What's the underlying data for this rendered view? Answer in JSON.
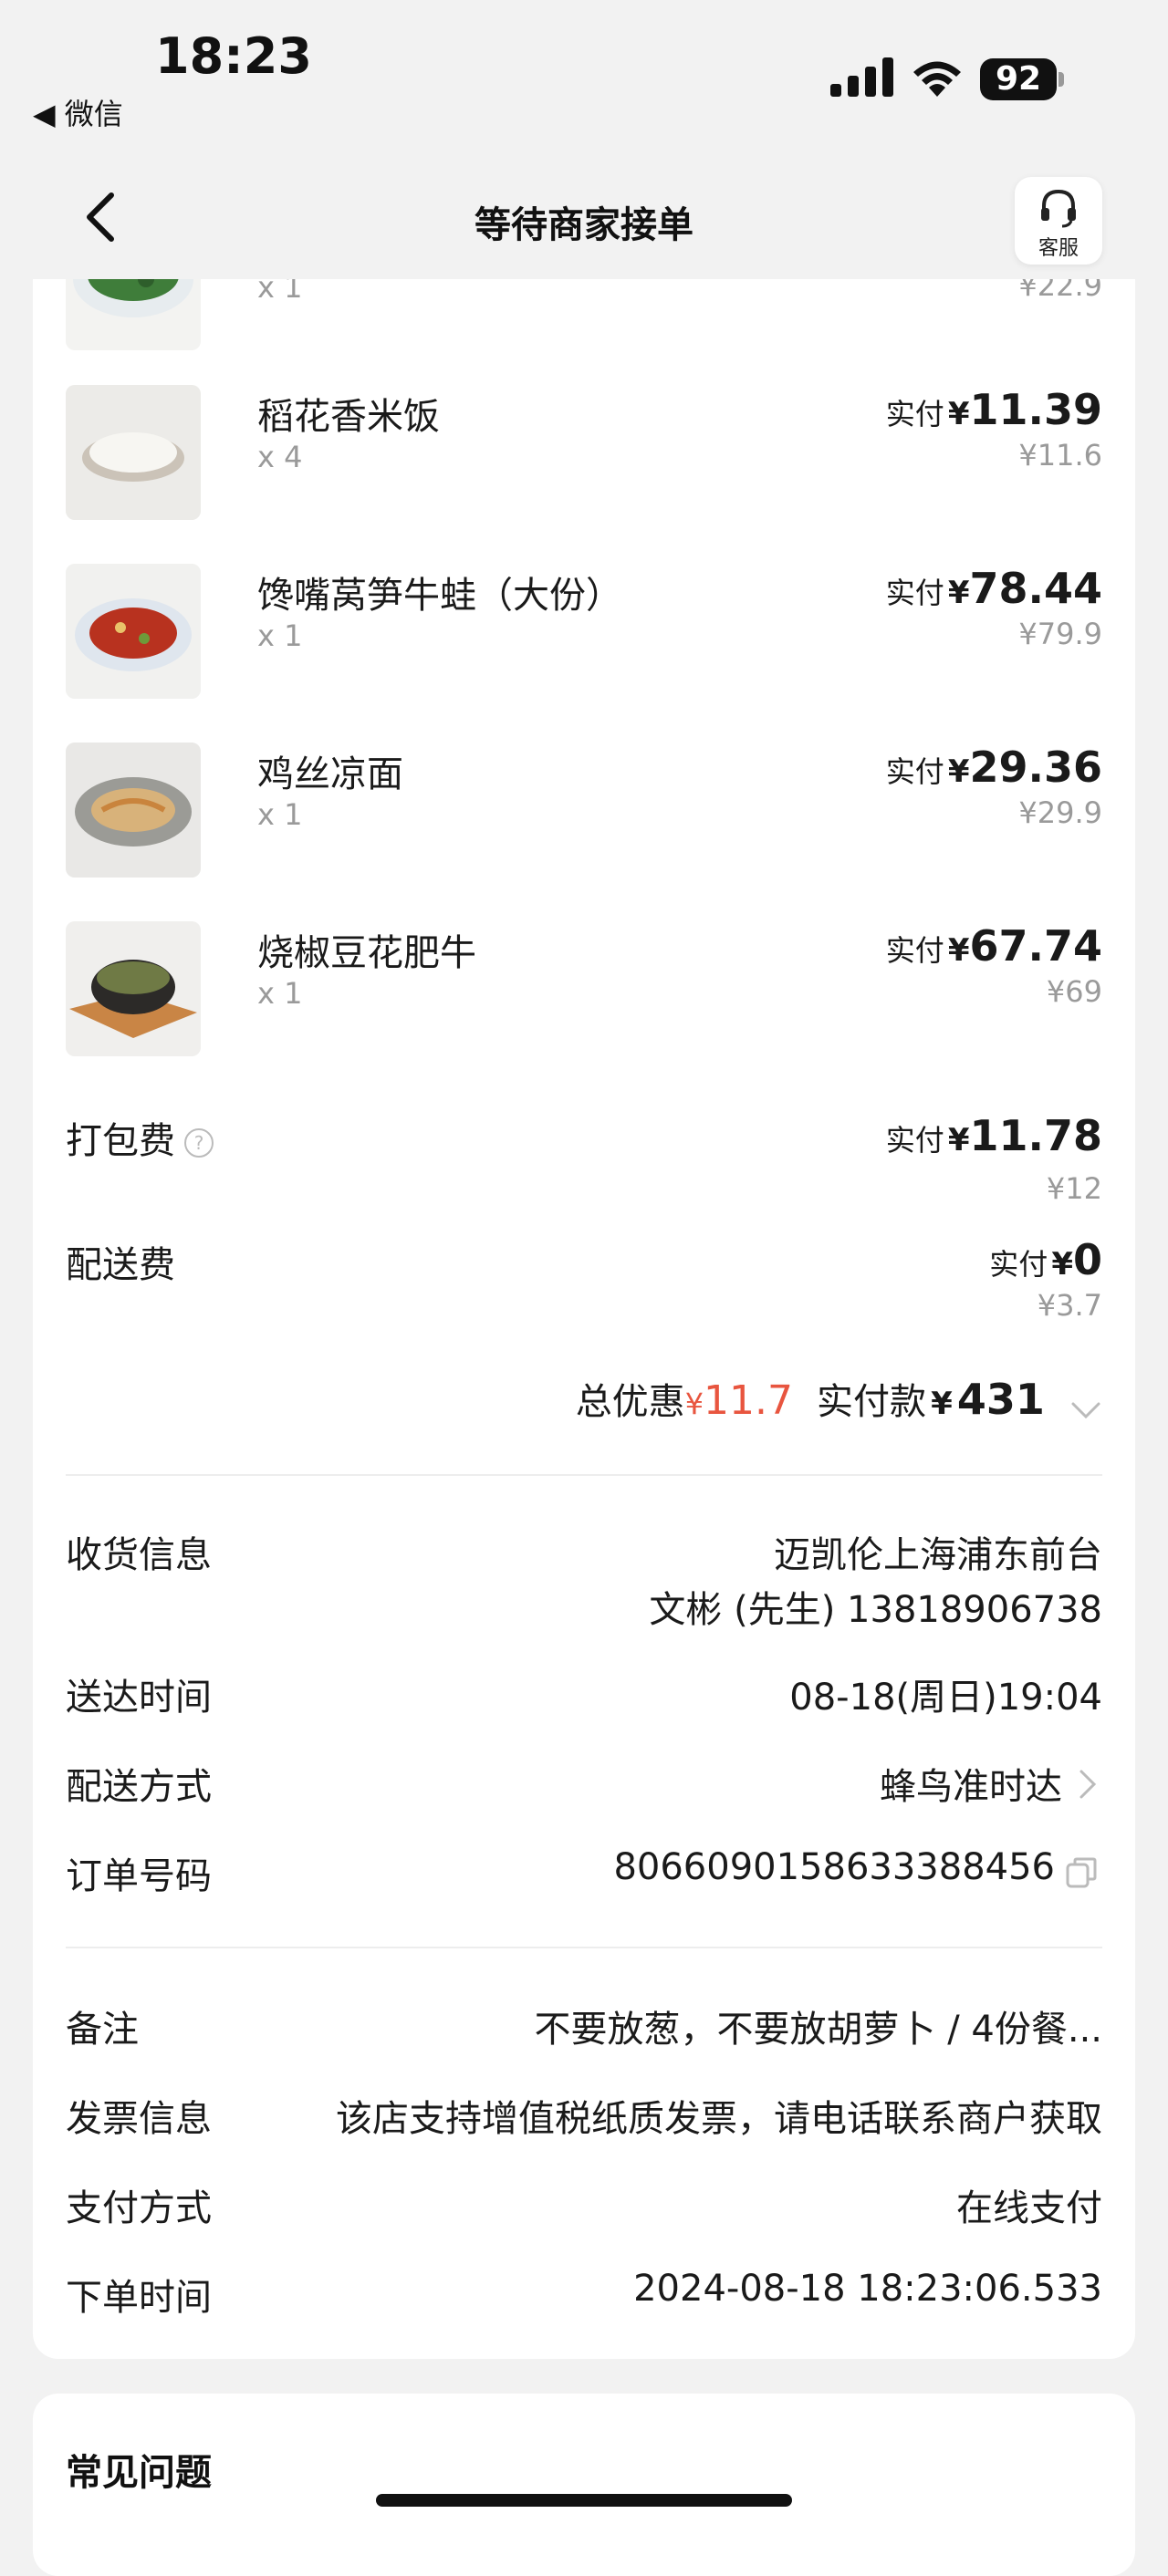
{
  "status_bar": {
    "time": "18:23",
    "back_app": "◀ 微信",
    "battery": "92"
  },
  "nav": {
    "title": "等待商家接单",
    "service_label": "客服"
  },
  "partial_item": {
    "qty": "x 1",
    "orig": "¥22.9"
  },
  "items": [
    {
      "name": "稻花香米饭",
      "qty": "x 4",
      "paid_label": "实付",
      "yen": "¥",
      "paid": "11.39",
      "orig": "¥11.6"
    },
    {
      "name": "馋嘴莴笋牛蛙（大份）",
      "qty": "x 1",
      "paid_label": "实付",
      "yen": "¥",
      "paid": "78.44",
      "orig": "¥79.9"
    },
    {
      "name": "鸡丝凉面",
      "qty": "x 1",
      "paid_label": "实付",
      "yen": "¥",
      "paid": "29.36",
      "orig": "¥29.9"
    },
    {
      "name": "烧椒豆花肥牛",
      "qty": "x 1",
      "paid_label": "实付",
      "yen": "¥",
      "paid": "67.74",
      "orig": "¥69"
    }
  ],
  "fees": [
    {
      "label": "打包费",
      "help": "?",
      "paid_label": "实付",
      "yen": "¥",
      "paid": "11.78",
      "orig": "¥12"
    },
    {
      "label": "配送费",
      "paid_label": "实付",
      "yen": "¥",
      "paid": "0",
      "orig": "¥3.7"
    }
  ],
  "totals": {
    "discount_label": "总优惠",
    "discount_yen": "¥",
    "discount": "11.7",
    "paid_label": "实付款",
    "paid_yen": "¥",
    "paid": "431"
  },
  "info": {
    "address_label": "收货信息",
    "address_line1": "迈凯伦上海浦东前台",
    "address_line2": "文彬 (先生) 13818906738",
    "delivery_time_label": "送达时间",
    "delivery_time": "08-18(周日)19:04",
    "delivery_method_label": "配送方式",
    "delivery_method": "蜂鸟准时达",
    "order_no_label": "订单号码",
    "order_no": "8066090158633388456",
    "remark_label": "备注",
    "remark": "不要放葱，不要放胡萝卜 / 4份餐...",
    "invoice_label": "发票信息",
    "invoice": "该店支持增值税纸质发票，请电话联系商户获取",
    "payment_label": "支付方式",
    "payment": "在线支付",
    "order_time_label": "下单时间",
    "order_time": "2024-08-18 18:23:06.533"
  },
  "faq": {
    "title": "常见问题"
  },
  "icons": {
    "back": "chevron-left-icon",
    "service": "headset-icon",
    "help": "question-circle-icon",
    "expand": "chevron-down-icon",
    "arrow": "chevron-right-icon",
    "copy": "copy-icon"
  },
  "colors": {
    "accent_discount": "#e8553f",
    "background": "#f2f2f2"
  }
}
